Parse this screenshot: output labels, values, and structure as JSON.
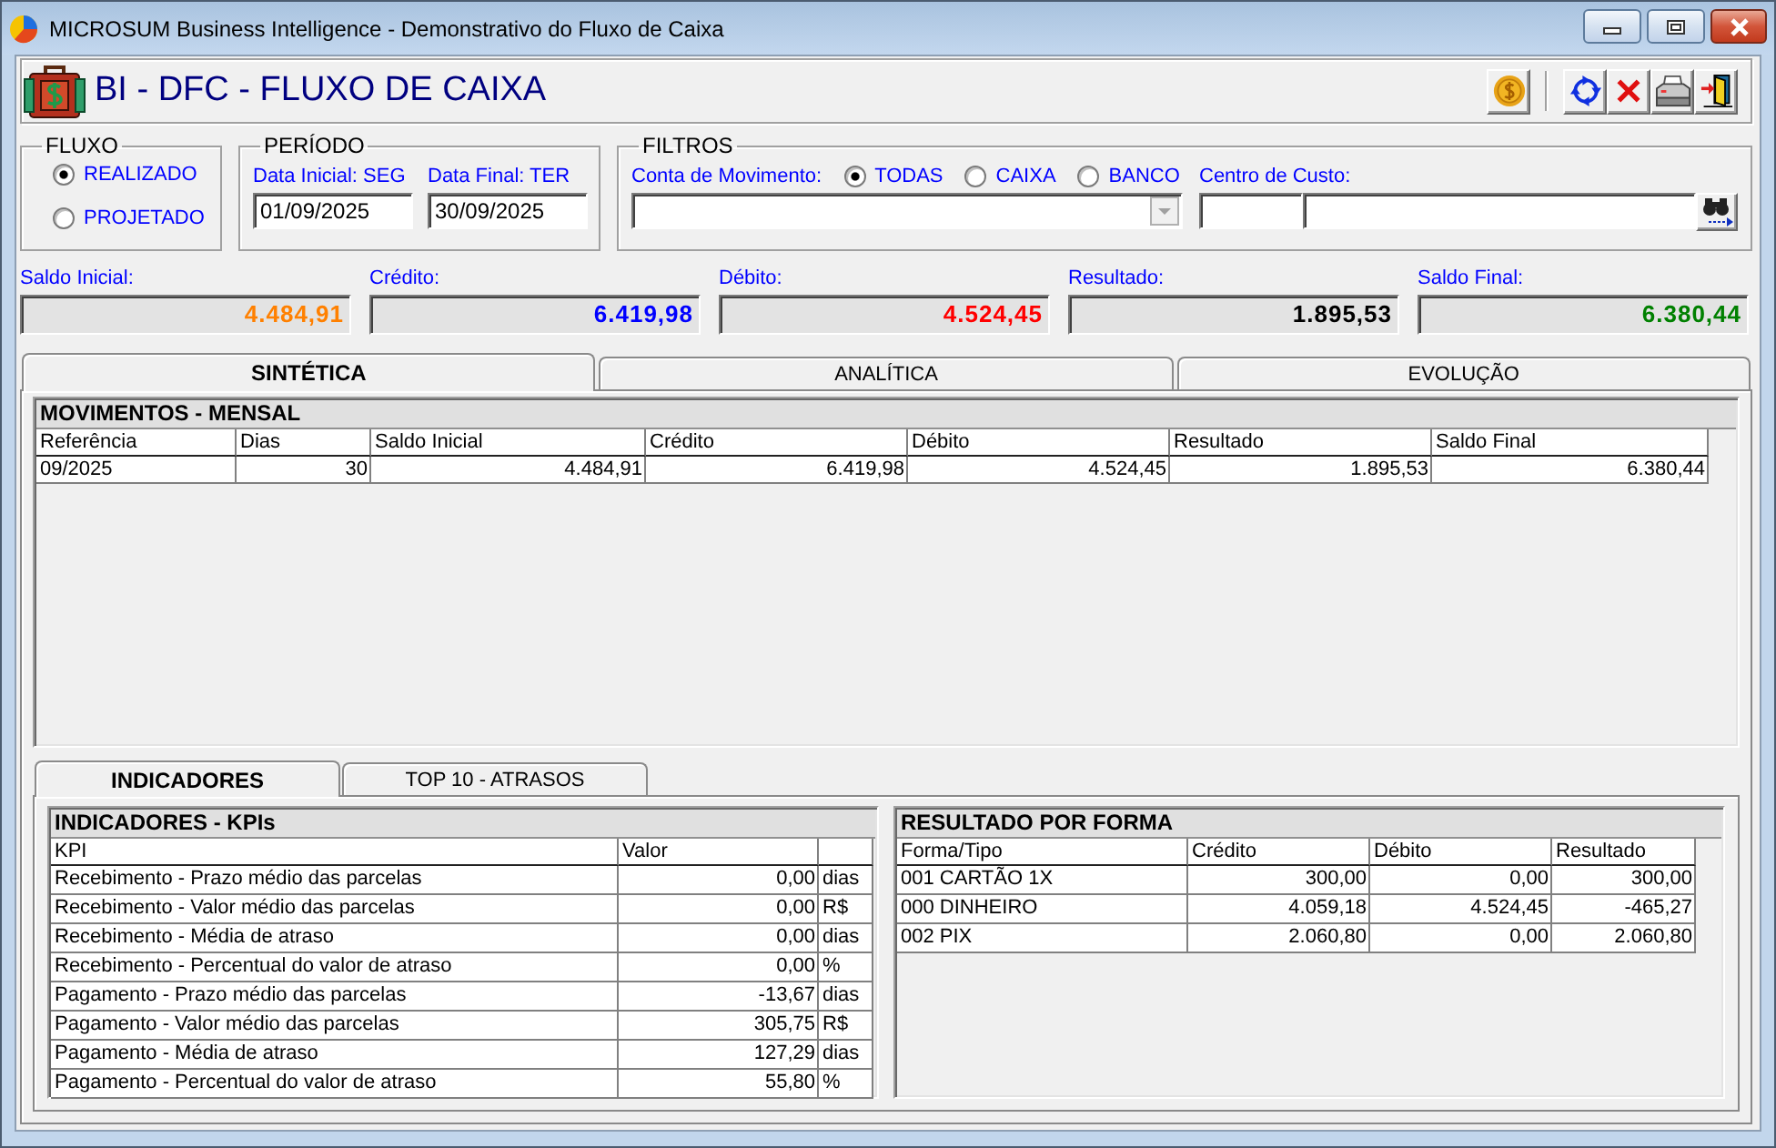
{
  "window": {
    "title": "MICROSUM Business Intelligence - Demonstrativo do Fluxo de Caixa"
  },
  "header": {
    "title": "BI - DFC - FLUXO DE CAIXA"
  },
  "fluxo": {
    "label": "FLUXO",
    "options": [
      {
        "label": "REALIZADO",
        "selected": true
      },
      {
        "label": "PROJETADO",
        "selected": false
      }
    ]
  },
  "periodo": {
    "label": "PERÍODO",
    "fields": [
      {
        "label": "Data Inicial: SEG",
        "value": "01/09/2025"
      },
      {
        "label": "Data Final: TER",
        "value": "30/09/2025"
      }
    ]
  },
  "filtros": {
    "label": "FILTROS",
    "account_label": "Conta de Movimento:",
    "account_options": [
      {
        "label": "TODAS",
        "selected": true
      },
      {
        "label": "CAIXA",
        "selected": false
      },
      {
        "label": "BANCO",
        "selected": false
      }
    ],
    "cost_center_label": "Centro de Custo:"
  },
  "summary": [
    {
      "label": "Saldo Inicial:",
      "value": "4.484,91",
      "color": "#ff8000"
    },
    {
      "label": "Crédito:",
      "value": "6.419,98",
      "color": "#0000ff"
    },
    {
      "label": "Débito:",
      "value": "4.524,45",
      "color": "#ff0000"
    },
    {
      "label": "Resultado:",
      "value": "1.895,53",
      "color": "#000000"
    },
    {
      "label": "Saldo Final:",
      "value": "6.380,44",
      "color": "#008000"
    }
  ],
  "tabs": [
    {
      "label": "SINTÉTICA",
      "selected": true
    },
    {
      "label": "ANALÍTICA",
      "selected": false
    },
    {
      "label": "EVOLUÇÃO",
      "selected": false
    }
  ],
  "movimentos": {
    "title": "MOVIMENTOS - MENSAL",
    "columns": [
      "Referência",
      "Dias",
      "Saldo Inicial",
      "Crédito",
      "Débito",
      "Resultado",
      "Saldo Final"
    ],
    "rows": [
      [
        "09/2025",
        "30",
        "4.484,91",
        "6.419,98",
        "4.524,45",
        "1.895,53",
        "6.380,44"
      ]
    ]
  },
  "sub_tabs": [
    {
      "label": "INDICADORES",
      "selected": true
    },
    {
      "label": "TOP 10 - ATRASOS",
      "selected": false
    }
  ],
  "kpis": {
    "title": "INDICADORES - KPIs",
    "columns": [
      "KPI",
      "Valor"
    ],
    "rows": [
      {
        "kpi": "Recebimento - Prazo médio das parcelas",
        "value": "0,00",
        "unit": "dias"
      },
      {
        "kpi": "Recebimento - Valor médio das parcelas",
        "value": "0,00",
        "unit": "R$"
      },
      {
        "kpi": "Recebimento - Média de atraso",
        "value": "0,00",
        "unit": "dias"
      },
      {
        "kpi": "Recebimento - Percentual do valor de atraso",
        "value": "0,00",
        "unit": "%"
      },
      {
        "kpi": "Pagamento - Prazo médio das parcelas",
        "value": "-13,67",
        "unit": "dias"
      },
      {
        "kpi": "Pagamento - Valor médio das parcelas",
        "value": "305,75",
        "unit": "R$"
      },
      {
        "kpi": "Pagamento - Média de atraso",
        "value": "127,29",
        "unit": "dias"
      },
      {
        "kpi": "Pagamento - Percentual do valor de atraso",
        "value": "55,80",
        "unit": "%"
      }
    ]
  },
  "resultado_por_forma": {
    "title": "RESULTADO POR FORMA",
    "columns": [
      "Forma/Tipo",
      "Crédito",
      "Débito",
      "Resultado"
    ],
    "rows": [
      [
        "001 CARTÃO 1X",
        "300,00",
        "0,00",
        "300,00"
      ],
      [
        "000 DINHEIRO",
        "4.059,18",
        "4.524,45",
        "-465,27"
      ],
      [
        "002 PIX",
        "2.060,80",
        "0,00",
        "2.060,80"
      ]
    ]
  }
}
